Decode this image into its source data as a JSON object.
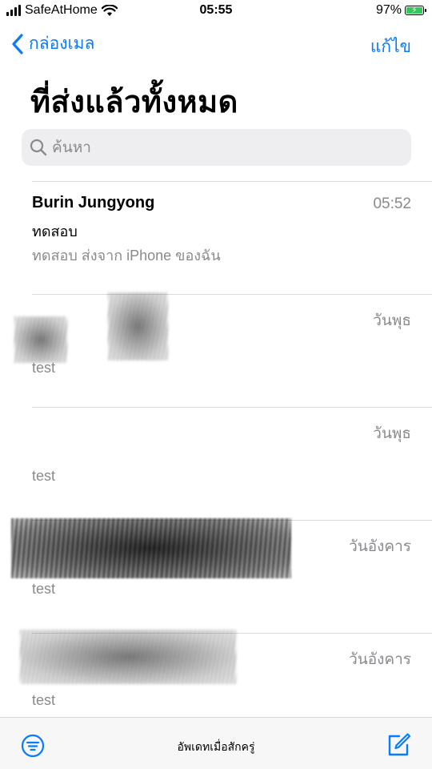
{
  "status_bar": {
    "carrier": "SafeAtHome",
    "time": "05:55",
    "battery": "97%"
  },
  "nav": {
    "back_label": "กล่องเมล",
    "edit_label": "แก้ไข"
  },
  "title": "ที่ส่งแล้วทั้งหมด",
  "search": {
    "placeholder": "ค้นหา"
  },
  "mails": [
    {
      "sender": "Burin Jungyong",
      "time": "05:52",
      "subject": "ทดสอบ",
      "preview": "ทดสอบ ส่งจาก iPhone ของฉัน"
    },
    {
      "sender": "",
      "time": "วันพุธ",
      "subject": "",
      "preview": "test"
    },
    {
      "sender": "",
      "time": "วันพุธ",
      "subject": "",
      "preview": "test"
    },
    {
      "sender": "",
      "time": "วันอังคาร",
      "subject": "",
      "preview": "test"
    },
    {
      "sender": "",
      "time": "วันอังคาร",
      "subject": "",
      "preview": "test"
    }
  ],
  "toolbar": {
    "updated_text": "อัพเดทเมื่อสักครู่"
  },
  "colors": {
    "accent": "#0a7aff",
    "secondary_text": "#8a8a8e",
    "battery": "#34c759"
  },
  "icons": {
    "back": "chevron-left-icon",
    "search": "search-icon",
    "filter": "filter-icon",
    "compose": "compose-icon"
  }
}
